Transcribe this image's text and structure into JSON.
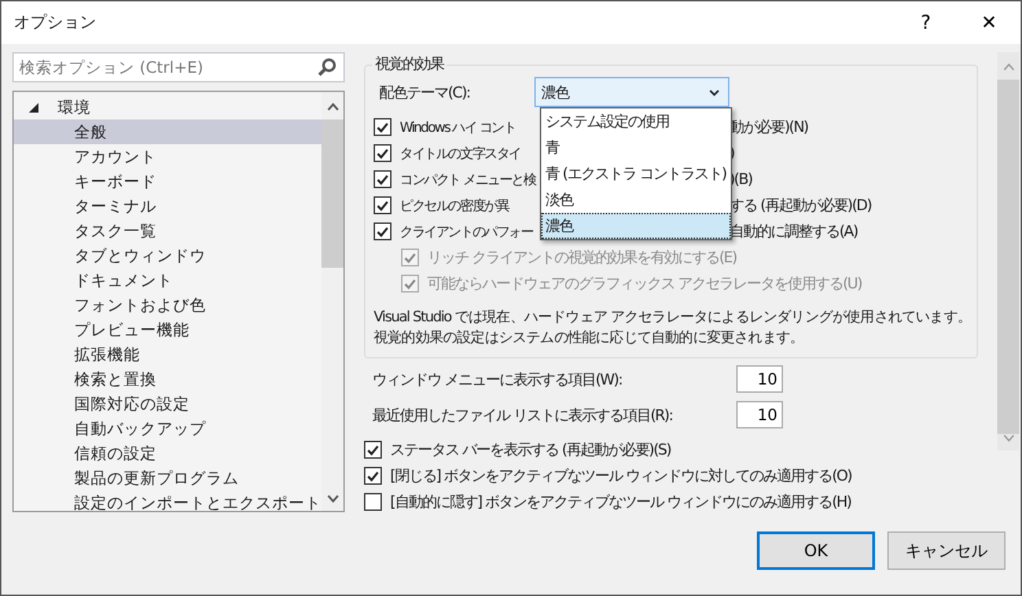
{
  "window": {
    "title": "オプション",
    "help": "?",
    "close": "✕"
  },
  "search": {
    "placeholder": "検索オプション (Ctrl+E)"
  },
  "tree": {
    "items": [
      {
        "label": "環境",
        "expanded": true,
        "selected": false,
        "children": [
          {
            "label": "全般",
            "selected": true
          },
          {
            "label": "アカウント",
            "selected": false
          },
          {
            "label": "キーボード",
            "selected": false
          },
          {
            "label": "ターミナル",
            "selected": false
          },
          {
            "label": "タスク一覧",
            "selected": false
          },
          {
            "label": "タブとウィンドウ",
            "selected": false
          },
          {
            "label": "ドキュメント",
            "selected": false
          },
          {
            "label": "フォントおよび色",
            "selected": false
          },
          {
            "label": "プレビュー機能",
            "selected": false
          },
          {
            "label": "拡張機能",
            "selected": false
          },
          {
            "label": "検索と置換",
            "selected": false
          },
          {
            "label": "国際対応の設定",
            "selected": false
          },
          {
            "label": "自動バックアップ",
            "selected": false
          },
          {
            "label": "信頼の設定",
            "selected": false
          },
          {
            "label": "製品の更新プログラム",
            "selected": false
          },
          {
            "label": "設定のインポートとエクスポート",
            "selected": false
          }
        ]
      }
    ]
  },
  "group": {
    "title": "視覚的効果",
    "theme": {
      "label": "配色テーマ(C):",
      "value": "濃色",
      "expanded": true,
      "options": [
        {
          "label": "システム設定の使用",
          "selected": false
        },
        {
          "label": "青",
          "selected": false
        },
        {
          "label": "青 (エクストラ コントラスト)",
          "selected": false
        },
        {
          "label": "淡色",
          "selected": false
        },
        {
          "label": "濃色",
          "selected": true
        }
      ]
    },
    "checkboxes": [
      {
        "label_start": "Windows ハイ コント",
        "label_end": "動が必要)(N)",
        "checked": true,
        "disabled": false
      },
      {
        "label_start": "タイトルの文字スタイ",
        "label_end": ")",
        "checked": true,
        "disabled": false
      },
      {
        "label_start": "コンパクト メニューと検",
        "label_end": ")(B)",
        "checked": true,
        "disabled": false
      },
      {
        "label_start": "ピクセルの密度が異",
        "label_end": "する (再起動が必要)(D)",
        "checked": true,
        "disabled": false
      },
      {
        "label_start": "クライアントのパフォー",
        "label_end": "自動的に調整する(A)",
        "checked": true,
        "disabled": false,
        "children": [
          {
            "label_start": "リッチ クライアントの視覚的効果を有効にする(E)",
            "checked": true,
            "disabled": true
          },
          {
            "label_start": "可能ならハードウェアのグラフィックス アクセラレータを使用する(U)",
            "checked": true,
            "disabled": true
          }
        ]
      }
    ],
    "note_lines": [
      "Visual Studio では現在、ハードウェア アクセラレータによるレンダリングが使用されています。",
      "視覚的効果の設定はシステムの性能に応じて自動的に変更されます。"
    ]
  },
  "number_fields": [
    {
      "label": "ウィンドウ メニューに表示する項目(W):",
      "value": "10"
    },
    {
      "label": "最近使用したファイル リストに表示する項目(R):",
      "value": "10"
    }
  ],
  "checkboxes": [
    {
      "label": "ステータス バーを表示する (再起動が必要)(S)",
      "checked": true
    },
    {
      "label": "[閉じる] ボタンをアクティブなツール ウィンドウに対してのみ適用する(O)",
      "checked": true
    },
    {
      "label": "[自動的に隠す] ボタンをアクティブなツール ウィンドウにのみ適用する(H)",
      "checked": false
    }
  ],
  "buttons": [
    {
      "label": "OK",
      "default": true
    },
    {
      "label": "キャンセル",
      "default": false
    }
  ]
}
